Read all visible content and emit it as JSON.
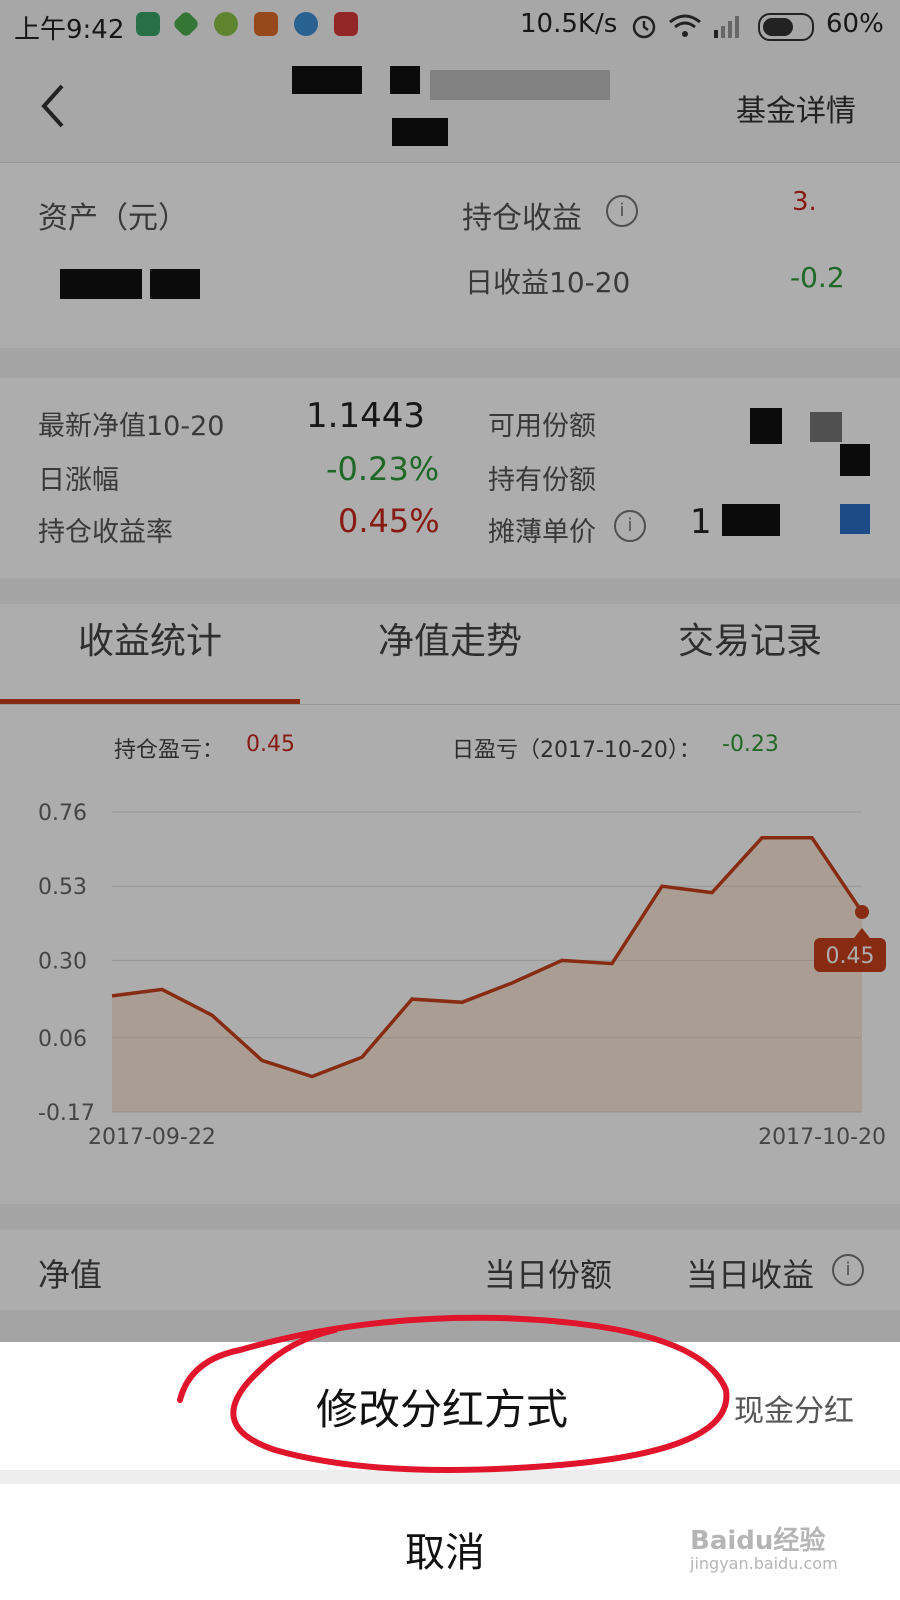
{
  "status_bar": {
    "time": "上午9:42",
    "app_icons": [
      "shield-icon",
      "diamond-icon",
      "sync-icon",
      "taobao-icon",
      "clock-app-icon",
      "listen-app-icon"
    ],
    "net_speed": "10.5K/s",
    "battery": "60%"
  },
  "nav": {
    "back_icon": "chevron-left-icon",
    "action": "基金详情"
  },
  "summary": {
    "asset_label": "资产（元）",
    "holding_profit_label": "持仓收益",
    "holding_profit_value": "3.",
    "daily_label": "日收益10-20",
    "daily_value": "-0.2"
  },
  "details": {
    "nav_label": "最新净值10-20",
    "nav_value": "1.1443",
    "change_label": "日涨幅",
    "change_value": "-0.23%",
    "rate_label": "持仓收益率",
    "rate_value": "0.45%",
    "available_label": "可用份额",
    "held_label": "持有份额",
    "unit_cost_label": "摊薄单价",
    "unit_cost_value": "1"
  },
  "tabs": [
    {
      "label": "收益统计",
      "active": true
    },
    {
      "label": "净值走势",
      "active": false
    },
    {
      "label": "交易记录",
      "active": false
    }
  ],
  "stats": {
    "holding_label": "持仓盈亏：",
    "holding_value": "0.45",
    "daily_label": "日盈亏（2017-10-20）：",
    "daily_value": "-0.23"
  },
  "chart_data": {
    "type": "area",
    "y_ticks": [
      "0.76",
      "0.53",
      "0.30",
      "0.06",
      "-0.17"
    ],
    "ylim": [
      -0.17,
      0.76
    ],
    "x_labels": [
      "2017-09-22",
      "2017-10-20"
    ],
    "values": [
      0.19,
      0.21,
      0.13,
      -0.01,
      -0.06,
      0.0,
      0.18,
      0.17,
      0.23,
      0.3,
      0.29,
      0.53,
      0.51,
      0.68,
      0.68,
      0.45
    ],
    "last_label": "0.45",
    "line_color": "#c8411c"
  },
  "table_header": {
    "col1": "净值",
    "col2": "当日份额",
    "col3": "当日收益"
  },
  "sheet": {
    "option_label": "修改分红方式",
    "option_value": "现金分红",
    "cancel": "取消"
  },
  "watermark": "Baidu经验 jingyan.baidu.com"
}
